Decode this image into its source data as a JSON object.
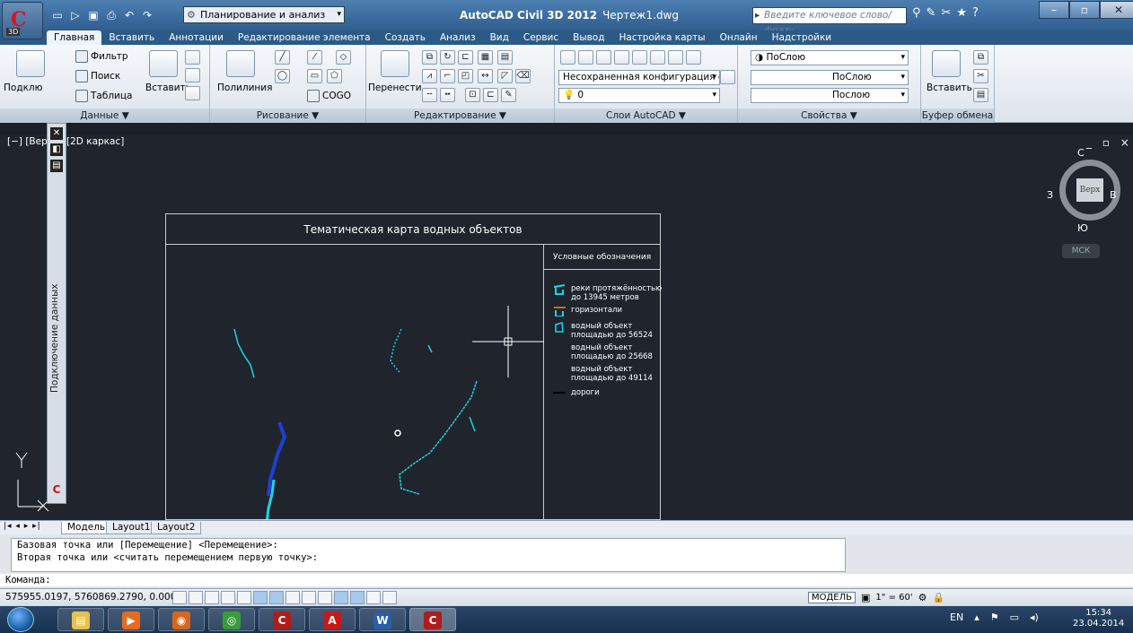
{
  "titlebar": {
    "app_badge": "3D",
    "workspace": "Планирование и анализ",
    "app_title": "AutoCAD Civil 3D 2012",
    "doc_title": "Чертеж1.dwg",
    "search_placeholder": "Введите ключевое слово/фразу"
  },
  "tabs": [
    "Главная",
    "Вставить",
    "Аннотации",
    "Редактирование элемента",
    "Создать",
    "Анализ",
    "Вид",
    "Сервис",
    "Вывод",
    "Настройка карты",
    "Онлайн",
    "Надстройки"
  ],
  "ribbon": {
    "data": {
      "connect": "Подклю",
      "filter": "Фильтр",
      "search": "Поиск",
      "table": "Таблица",
      "insert": "Вставить",
      "title": "Данные ▼"
    },
    "draw": {
      "polyline": "Полилиния",
      "cogo": "COGO",
      "title": "Рисование ▼"
    },
    "edit": {
      "move": "Перенести",
      "title": "Редактирование ▼"
    },
    "layers": {
      "config": "Несохраненная конфигурация сл▾",
      "layer": "0",
      "title": "Слои AutoCAD ▼"
    },
    "props": {
      "color": "ПоСлою",
      "linetype": "ПоСлою",
      "lineweight": "Послою",
      "title": "Свойства ▼"
    },
    "clip": {
      "insert": "Вставить",
      "title": "Буфер обмена"
    }
  },
  "viewport": {
    "label": "[−] [Вер… ] [2D каркас]",
    "controls": "_ ▫ ×"
  },
  "palette": {
    "title": "Подключение данных"
  },
  "map": {
    "title": "Тематическая карта водных объектов",
    "legend_title": "Условные обозначения",
    "legend": [
      {
        "text1": "реки протяжённостью",
        "text2": "до 13945 метров",
        "color": "#19d6e6"
      },
      {
        "text1": "горизонтали",
        "text2": "",
        "color": "#d2691e"
      },
      {
        "text1": "водный объект",
        "text2": "площадью до 56524",
        "color": "#19d6e6"
      },
      {
        "text1": "водный объект",
        "text2": "площадью до 25668",
        "color": "#19d6e6"
      },
      {
        "text1": "водный объект",
        "text2": "площадью до 49114",
        "color": "#19d6e6"
      },
      {
        "text1": "дороги",
        "text2": "",
        "color": "#000000"
      }
    ]
  },
  "compass": {
    "n": "С",
    "s": "Ю",
    "w": "З",
    "e": "В",
    "cube": "Верх",
    "ucs": "МСК"
  },
  "layouts": [
    "Модель",
    "Layout1",
    "Layout2"
  ],
  "command": {
    "line1": "Базовая точка или [Перемещение] <Перемещение>:",
    "line2": "Вторая точка или <считать перемещением первую точку>:",
    "prompt": "Команда:"
  },
  "status": {
    "coords": "575955.0197, 5760869.2790, 0.0000",
    "model": "МОДЕЛЬ",
    "scale": "1\" = 60'"
  },
  "taskbar": {
    "lang": "EN",
    "time": "15:34",
    "date": "23.04.2014"
  }
}
